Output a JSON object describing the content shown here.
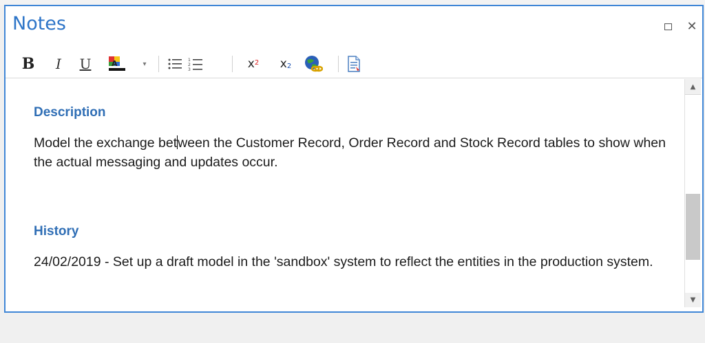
{
  "window": {
    "title": "Notes",
    "maximize_label": "□",
    "close_label": "✕"
  },
  "toolbar": {
    "bold_label": "B",
    "italic_label": "I",
    "underline_label": "U",
    "dropdown_arrow": "▾",
    "superscript_label": "x",
    "superscript_mark": "2",
    "subscript_label": "x",
    "subscript_mark": "2"
  },
  "document": {
    "description_heading": "Description",
    "description_text_before_caret": "Model the exchange bet",
    "description_text_after_caret": "ween the Customer Record, Order Record and Stock Record tables to show when the actual messaging and updates occur.",
    "history_heading": "History",
    "history_text": "24/02/2019 - Set up a draft model in the 'sandbox' system to reflect the entities in the production system."
  },
  "scrollbar": {
    "up_arrow": "▲",
    "down_arrow": "▼",
    "position": 0.75
  },
  "colors": {
    "accent": "#3f86d6",
    "title": "#2e75c8",
    "heading": "#2f6eb5"
  }
}
